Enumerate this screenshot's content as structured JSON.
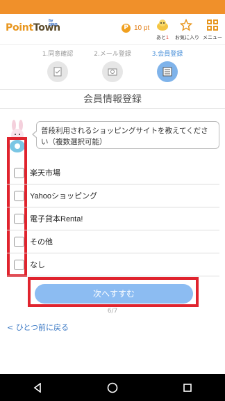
{
  "header": {
    "logo_main": "Point",
    "logo_town": "Town",
    "logo_gmo": "by GMO",
    "points_coin": "P",
    "points_value": "10 pt",
    "ato_prefix": "あと",
    "ato_count": "1",
    "favorites_label": "お気に入り",
    "menu_label": "メニュー"
  },
  "steps": [
    {
      "label": "1.同意確認",
      "icon": "document-check-icon"
    },
    {
      "label": "2.メール登録",
      "icon": "email-icon"
    },
    {
      "label": "3.会員登録",
      "icon": "form-icon"
    }
  ],
  "page_title": "会員情報登録",
  "question": "普段利用されるショッピングサイトを教えてください（複数選択可能）",
  "options": [
    "楽天市場",
    "Yahooショッピング",
    "電子貸本Renta!",
    "その他",
    "なし"
  ],
  "next_button": "次へすすむ",
  "pager": "6/7",
  "back_link": "< ひとつ前に戻る",
  "colors": {
    "status_bar": "#f0902a",
    "accent_blue": "#7fb3ea",
    "highlight_red": "#e0242e"
  }
}
